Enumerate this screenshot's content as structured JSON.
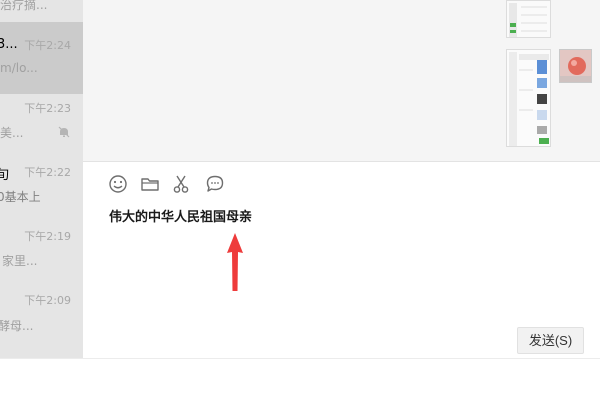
{
  "sidebar": {
    "items": [
      {
        "name": "",
        "time": "",
        "snippet": "治疗摘..."
      },
      {
        "name": "3...",
        "time": "下午2:24",
        "snippet": "m/lo...",
        "active": true
      },
      {
        "name": "",
        "time": "下午2:23",
        "snippet": "美...",
        "muted": true
      },
      {
        "name": "旬",
        "time": "下午2:22",
        "snippet": "0基本上"
      },
      {
        "name": "",
        "time": "下午2:19",
        "snippet": "家里..."
      },
      {
        "name": "",
        "time": "下午2:09",
        "snippet": "酵母..."
      }
    ]
  },
  "composer": {
    "input_text": "伟大的中华人民祖国母亲",
    "send_label": "发送(S)",
    "toolbar_icons": [
      "emoji-icon",
      "folder-icon",
      "scissors-icon",
      "chat-history-icon"
    ]
  },
  "annotation": {
    "arrow_color": "#ee3b3b"
  },
  "colors": {
    "sidebar_bg": "#e5e5e5",
    "active_item_bg": "#cbcbcb",
    "message_bg": "#f5f5f5"
  }
}
